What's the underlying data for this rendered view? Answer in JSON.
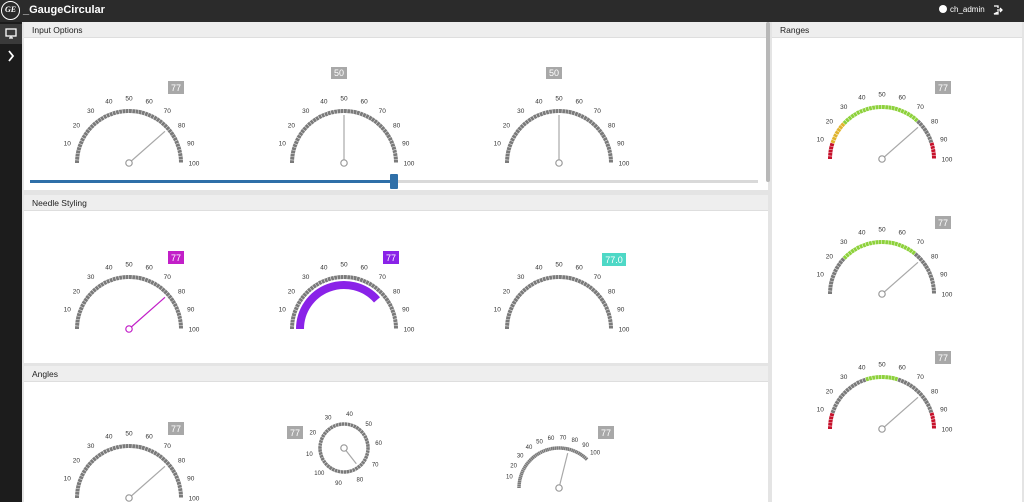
{
  "app": {
    "logo_text": "GE",
    "title": "_GaugeCircular"
  },
  "header": {
    "user": "ch_admin"
  },
  "nav": {
    "items": [
      {
        "icon": "monitor-icon"
      },
      {
        "icon": "chevron-right-icon"
      }
    ]
  },
  "panels": {
    "input_options": {
      "title": "Input Options"
    },
    "needle_styling": {
      "title": "Needle Styling"
    },
    "angles": {
      "title": "Angles"
    },
    "ranges": {
      "title": "Ranges"
    }
  },
  "slider": {
    "value_fraction": 0.5
  },
  "colors": {
    "accent_blue": "#2f6fa8",
    "gray_tick": "#7a7a7a",
    "badge_gray": "#a8a8a8",
    "magenta": "#c21fc8",
    "purple": "#8a22e8",
    "teal": "#4ed8c6",
    "green": "#8dd13b",
    "yellow": "#e0b42e",
    "red": "#c6112b"
  },
  "gauges": [
    {
      "id": "input-1",
      "value": 77,
      "badge": "77",
      "needle": 77,
      "badge_color": "#a8a8a8",
      "needle_color": "#a8a8a8",
      "tick_labels": [
        "10",
        "20",
        "30",
        "40",
        "50",
        "60",
        "70",
        "80",
        "90",
        "100"
      ]
    },
    {
      "id": "input-2",
      "value": 50,
      "badge": "50",
      "needle": 50,
      "badge_color": "#a8a8a8",
      "needle_color": "#a8a8a8",
      "tick_labels": [
        "10",
        "20",
        "30",
        "40",
        "50",
        "60",
        "70",
        "80",
        "90",
        "100"
      ]
    },
    {
      "id": "input-3",
      "value": 50,
      "badge": "50",
      "needle": 50,
      "badge_color": "#a8a8a8",
      "needle_color": "#a8a8a8",
      "tick_labels": [
        "10",
        "20",
        "30",
        "40",
        "50",
        "60",
        "70",
        "80",
        "90",
        "100"
      ]
    },
    {
      "id": "needle-1",
      "value": 77,
      "badge": "77",
      "needle": 77,
      "badge_color": "#c21fc8",
      "needle_color": "#c21fc8",
      "tick_labels": [
        "10",
        "20",
        "30",
        "40",
        "50",
        "60",
        "70",
        "80",
        "90",
        "100"
      ]
    },
    {
      "id": "needle-2",
      "value": 77,
      "badge": "77",
      "fill_bar": true,
      "badge_color": "#8a22e8",
      "needle_color": "#8a22e8",
      "tick_labels": [
        "10",
        "20",
        "30",
        "40",
        "50",
        "60",
        "70",
        "80",
        "90",
        "100"
      ]
    },
    {
      "id": "needle-3",
      "value": 77,
      "badge": "77.0",
      "no_needle": true,
      "badge_color": "#4ed8c6",
      "needle_color": "#4ed8c6",
      "tick_labels": [
        "10",
        "20",
        "30",
        "40",
        "50",
        "60",
        "70",
        "80",
        "90",
        "100"
      ]
    },
    {
      "id": "angles-1",
      "value": 77,
      "badge": "77",
      "needle": 77,
      "badge_color": "#a8a8a8",
      "needle_color": "#a8a8a8",
      "tick_labels": [
        "10",
        "20",
        "30",
        "40",
        "50",
        "60",
        "70",
        "80",
        "90",
        "100"
      ]
    },
    {
      "id": "angles-2",
      "value": 77,
      "badge": "77",
      "needle": 77,
      "full_circle": true,
      "badge_color": "#a8a8a8",
      "needle_color": "#a8a8a8",
      "tick_labels": [
        "10",
        "20",
        "30",
        "40",
        "50",
        "60",
        "70",
        "80",
        "90",
        "100"
      ]
    },
    {
      "id": "angles-3",
      "value": 77,
      "badge": "77",
      "needle": 77,
      "quarter": true,
      "badge_color": "#a8a8a8",
      "needle_color": "#a8a8a8",
      "tick_labels": [
        "10",
        "20",
        "30",
        "40",
        "50",
        "60",
        "70",
        "80",
        "90",
        "100"
      ]
    },
    {
      "id": "ranges-1",
      "value": 77,
      "badge": "77",
      "needle": 77,
      "ranges": "full",
      "badge_color": "#a8a8a8",
      "needle_color": "#a8a8a8",
      "tick_labels": [
        "10",
        "20",
        "30",
        "40",
        "50",
        "60",
        "70",
        "80",
        "90",
        "100"
      ]
    },
    {
      "id": "ranges-2",
      "value": 77,
      "badge": "77",
      "needle": 77,
      "ranges": "green_wide",
      "badge_color": "#a8a8a8",
      "needle_color": "#a8a8a8",
      "tick_labels": [
        "10",
        "20",
        "30",
        "40",
        "50",
        "60",
        "70",
        "80",
        "90",
        "100"
      ]
    },
    {
      "id": "ranges-3",
      "value": 77,
      "badge": "77",
      "needle": 77,
      "ranges": "green_red",
      "badge_color": "#a8a8a8",
      "needle_color": "#a8a8a8",
      "tick_labels": [
        "10",
        "20",
        "30",
        "40",
        "50",
        "60",
        "70",
        "80",
        "90",
        "100"
      ]
    }
  ]
}
